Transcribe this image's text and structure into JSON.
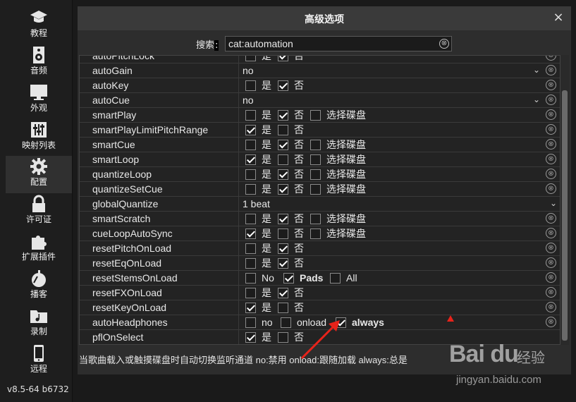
{
  "sidebar": {
    "items": [
      {
        "label": "教程",
        "icon": "graduation-cap-icon"
      },
      {
        "label": "音频",
        "icon": "speaker-icon"
      },
      {
        "label": "外观",
        "icon": "monitor-icon"
      },
      {
        "label": "映射列表",
        "icon": "sliders-icon"
      },
      {
        "label": "配置",
        "icon": "gear-icon"
      },
      {
        "label": "许可证",
        "icon": "lock-icon"
      },
      {
        "label": "扩展插件",
        "icon": "puzzle-icon"
      },
      {
        "label": "播客",
        "icon": "podcast-icon"
      },
      {
        "label": "录制",
        "icon": "folder-music-icon"
      },
      {
        "label": "远程",
        "icon": "phone-icon"
      }
    ],
    "version": "v8.5-64 b6732"
  },
  "dialog": {
    "title": "高级选项",
    "close": "×",
    "search_label": "搜索",
    "search_colon": ":",
    "search_value": "cat:automation",
    "clear_glyph": "⊗"
  },
  "labels": {
    "yes": "是",
    "no": "否",
    "select_disk": "选择碟盘",
    "no_en": "No",
    "pads": "Pads",
    "all": "All",
    "no_lc": "no",
    "onload": "onload",
    "always": "always"
  },
  "rows": [
    {
      "name": "autoPitchLock"
    },
    {
      "name": "autoGain",
      "select": "no"
    },
    {
      "name": "autoKey"
    },
    {
      "name": "autoCue",
      "select": "no"
    },
    {
      "name": "smartPlay"
    },
    {
      "name": "smartPlayLimitPitchRange"
    },
    {
      "name": "smartCue"
    },
    {
      "name": "smartLoop"
    },
    {
      "name": "quantizeLoop"
    },
    {
      "name": "quantizeSetCue"
    },
    {
      "name": "globalQuantize",
      "select": "1 beat"
    },
    {
      "name": "smartScratch"
    },
    {
      "name": "cueLoopAutoSync"
    },
    {
      "name": "resetPitchOnLoad"
    },
    {
      "name": "resetEqOnLoad"
    },
    {
      "name": "resetStemsOnLoad"
    },
    {
      "name": "resetFXOnLoad"
    },
    {
      "name": "resetKeyOnLoad"
    },
    {
      "name": "autoHeadphones"
    },
    {
      "name": "pflOnSelect"
    }
  ],
  "description": "当歌曲载入或触摸碟盘时自动切换监听通道  no:禁用  onload:跟随加载  always:总是",
  "watermark": {
    "logo": "Bai du",
    "cn": "经验",
    "url": "jingyan.baidu.com"
  },
  "colors": {
    "background": "#1a1a1a",
    "dialog": "#2d2d2d",
    "annotation": "#e8231a"
  }
}
